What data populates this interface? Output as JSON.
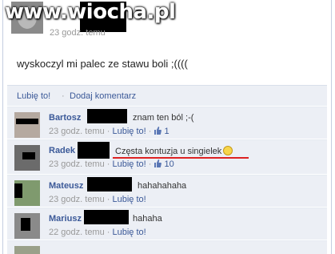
{
  "watermark": {
    "text_main": "www.w",
    "text_accent": "iocha",
    "text_tail": ".pl"
  },
  "post": {
    "time": "23 godz. temu",
    "text": "wyskoczyl mi palec ze stawu boli ;(((("
  },
  "actions": {
    "like": "Lubię to!",
    "separator": "·",
    "comment": "Dodaj komentarz"
  },
  "comments": [
    {
      "name": "Bartosz",
      "text": "znam ten ból ;-(",
      "time": "23 godz. temu",
      "like": "Lubię to!",
      "likes": "1"
    },
    {
      "name": "Radek",
      "text": "Częsta kontuzja u singielek",
      "time": "23 godz. temu",
      "like": "Lubię to!",
      "likes": "10"
    },
    {
      "name": "Mateusz",
      "text": "hahahahaha",
      "time": "23 godz. temu",
      "like": "Lubię to!"
    },
    {
      "name": "Mariusz",
      "text": "hahaha",
      "time": "22 godz. temu",
      "like": "Lubię to!"
    }
  ],
  "colors": {
    "link": "#3b5998",
    "comment_bg": "#eceff5",
    "highlight": "#dd2222"
  }
}
